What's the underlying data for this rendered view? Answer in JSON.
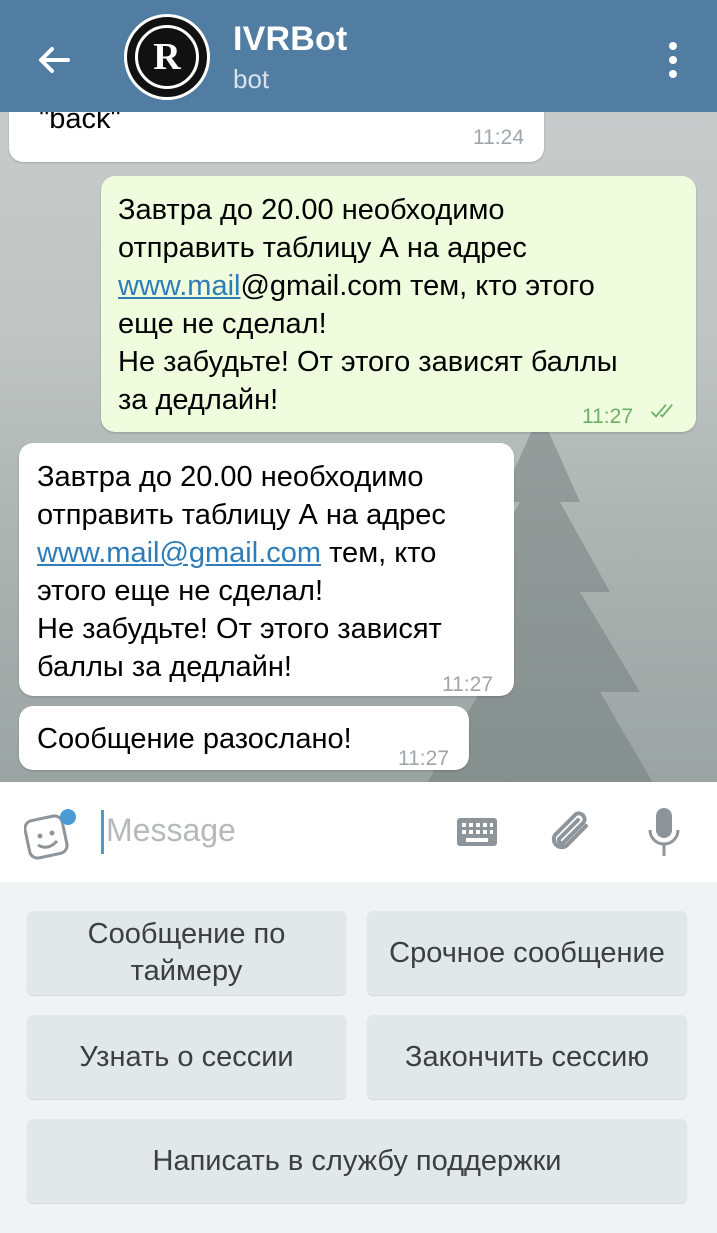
{
  "header": {
    "title": "IVRBot",
    "subtitle": "bot",
    "avatar_letter": "R"
  },
  "messages": [
    {
      "dir": "in",
      "text": "\"back\"",
      "time": "11:24"
    },
    {
      "dir": "out",
      "line1": "Завтра до 20.00 необходимо",
      "line2": "отправить таблицу А на адрес",
      "line3_link": "www.mail",
      "line3_rest": "@gmail.com тем, кто этого",
      "line4": "еще не сделал!",
      "line5": "Не забудьте! От этого зависят баллы",
      "line6": "за дедлайн!",
      "time": "11:27",
      "status": "read"
    },
    {
      "dir": "in",
      "line1": "Завтра до 20.00 необходимо",
      "line2": "отправить таблицу А на адрес",
      "line3_link": "www.mail@gmail.com",
      "line3_rest": " тем, кто",
      "line4": "этого еще не сделал!",
      "line5": "Не забудьте! От этого зависят",
      "line6": "баллы за дедлайн!",
      "time": "11:27"
    },
    {
      "dir": "in",
      "text": "Сообщение разослано!",
      "time": "11:27"
    }
  ],
  "input": {
    "placeholder": "Message"
  },
  "keyboard": {
    "row1": [
      "Сообщение по таймеру",
      "Срочное сообщение"
    ],
    "row2": [
      "Узнать о сессии",
      "Закончить сессию"
    ],
    "row3": [
      "Написать в службу поддержки"
    ]
  },
  "colors": {
    "header": "#517da2",
    "outgoing": "#effdde",
    "link": "#2e7cb8",
    "accent": "#4a9ad6"
  }
}
